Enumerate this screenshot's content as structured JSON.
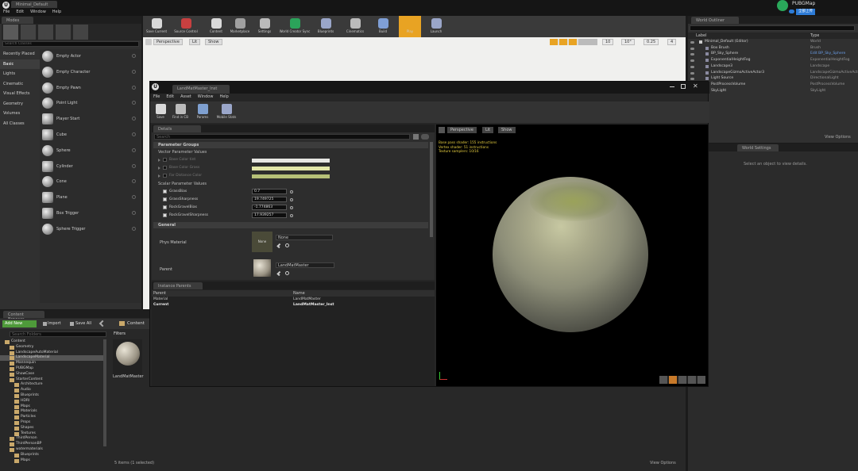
{
  "main": {
    "tab_title": "Minimal_Default",
    "menu": [
      "File",
      "Edit",
      "Window",
      "Help"
    ],
    "project_name": "PUBGMap",
    "badge": "全部上传"
  },
  "toolbar": [
    {
      "label": "Save Current",
      "color": "#d9d9d9"
    },
    {
      "label": "Source Control",
      "color": "#c74040"
    },
    {
      "label": "Content",
      "color": "#d9d9d9"
    },
    {
      "label": "Marketplace",
      "color": "#a0a0a0"
    },
    {
      "label": "Settings",
      "color": "#bbbbbb"
    },
    {
      "label": "World Creator Sync",
      "color": "#2ba35a"
    },
    {
      "label": "Blueprints",
      "color": "#9aa6c9"
    },
    {
      "label": "Cinematics",
      "color": "#bbbbbb"
    },
    {
      "label": "Build",
      "color": "#7f9fd6"
    },
    {
      "label": "Play",
      "color": "#e8a323"
    },
    {
      "label": "Launch",
      "color": "#9aa6c9"
    }
  ],
  "viewport": {
    "perspective": "Perspective",
    "lit": "Lit",
    "show": "Show",
    "grid": "10",
    "angle": "10°",
    "scale": "0.25",
    "cam": "4"
  },
  "modes": {
    "tab": "Modes",
    "search_placeholder": "Search Classes",
    "categories": [
      "Recently Placed",
      "Basic",
      "Lights",
      "Cinematic",
      "Visual Effects",
      "Geometry",
      "Volumes",
      "All Classes"
    ],
    "selected_category": "Basic",
    "items": [
      {
        "label": "Empty Actor",
        "icon": "empty-actor-icon"
      },
      {
        "label": "Empty Character",
        "icon": "empty-character-icon"
      },
      {
        "label": "Empty Pawn",
        "icon": "empty-pawn-icon"
      },
      {
        "label": "Point Light",
        "icon": "point-light-icon"
      },
      {
        "label": "Player Start",
        "icon": "player-start-icon"
      },
      {
        "label": "Cube",
        "icon": "cube-icon"
      },
      {
        "label": "Sphere",
        "icon": "sphere-icon"
      },
      {
        "label": "Cylinder",
        "icon": "cylinder-icon"
      },
      {
        "label": "Cone",
        "icon": "cone-icon"
      },
      {
        "label": "Plane",
        "icon": "plane-icon"
      },
      {
        "label": "Box Trigger",
        "icon": "box-trigger-icon"
      },
      {
        "label": "Sphere Trigger",
        "icon": "sphere-trigger-icon"
      }
    ]
  },
  "outliner": {
    "tab": "World Outliner",
    "col_label": "Label",
    "col_type": "Type",
    "rows": [
      {
        "label": "Minimal_Default (Editor)",
        "type": "World"
      },
      {
        "label": "Box Brush",
        "type": "Brush"
      },
      {
        "label": "BP_Sky_Sphere",
        "type": "Edit BP_Sky_Sphere"
      },
      {
        "label": "ExponentialHeightFog",
        "type": "ExponentialHeightFog"
      },
      {
        "label": "Landscape3",
        "type": "Landscape"
      },
      {
        "label": "LandscapeGizmoActiveActor3",
        "type": "LandscapeGizmoActiveActor"
      },
      {
        "label": "Light Source",
        "type": "DirectionalLight"
      },
      {
        "label": "PostProcessVolume",
        "type": "PostProcessVolume"
      },
      {
        "label": "SkyLight",
        "type": "SkyLight"
      }
    ],
    "view_options": "View Options"
  },
  "world_settings": {
    "tab": "World Settings",
    "empty_text": "Select an object to view details."
  },
  "material_editor": {
    "tab": "LandMatMaster_Inst",
    "menu": [
      "File",
      "Edit",
      "Asset",
      "Window",
      "Help"
    ],
    "toolbar": [
      "Save",
      "Find in CB",
      "Params",
      "Mobile Stats"
    ],
    "details_tab": "Details",
    "search_placeholder": "Search",
    "groups_header": "Parameter Groups",
    "vector_header": "Vector Parameter Values",
    "vector_params": [
      {
        "name": "Base Color tint",
        "color": "#e6e6e2"
      },
      {
        "name": "Base Color Grass",
        "color": "#e2e6a8"
      },
      {
        "name": "Far Distance Color",
        "color": "#b6c078"
      }
    ],
    "scalar_header": "Scalar Parameter Values",
    "scalar_params": [
      {
        "name": "GrassBias",
        "value": "0.7"
      },
      {
        "name": "GrassSharpness",
        "value": "19.749725"
      },
      {
        "name": "RockGravelBias",
        "value": "-1.774863"
      },
      {
        "name": "RockGravelSharpness",
        "value": "17.939257"
      }
    ],
    "general_header": "General",
    "phys_material_label": "Phys Material",
    "phys_material_value": "None",
    "phys_thumb_text": "None",
    "parent_label": "Parent",
    "parent_value": "LandMatMaster",
    "instance_tab": "Instance Parents",
    "instance_cols": [
      "Parent",
      "Name"
    ],
    "instance_rows": [
      [
        "Material",
        "LandMatMaster"
      ],
      [
        "Current",
        "LandMatMaster_Inst"
      ]
    ],
    "preview_perspective": "Perspective",
    "preview_lit": "Lit",
    "preview_show": "Show",
    "stats": [
      "Base pass shader: 155 instructions",
      "Vertex shader: 51 instructions",
      "Texture samplers: 10/16"
    ]
  },
  "content_browser": {
    "tab": "Content Browser",
    "add_new": "Add New",
    "import": "Import",
    "save_all": "Save All",
    "path": "Content",
    "search_folders": "Search Folders",
    "filters": "Filters",
    "asset_name": "LandMatMaster",
    "status": "5 items (1 selected)",
    "view_options": "View Options",
    "tree": [
      {
        "label": "Content",
        "indent": 0
      },
      {
        "label": "Geometry",
        "indent": 1
      },
      {
        "label": "LandscapeAutoMaterial",
        "indent": 1
      },
      {
        "label": "LandscapeMaterial",
        "indent": 1
      },
      {
        "label": "Mannequin",
        "indent": 1
      },
      {
        "label": "PUBGMap",
        "indent": 1
      },
      {
        "label": "ShowCase",
        "indent": 1
      },
      {
        "label": "StarterContent",
        "indent": 1
      },
      {
        "label": "Architecture",
        "indent": 2
      },
      {
        "label": "Audio",
        "indent": 2
      },
      {
        "label": "Blueprints",
        "indent": 2
      },
      {
        "label": "HDRI",
        "indent": 2
      },
      {
        "label": "Maps",
        "indent": 2
      },
      {
        "label": "Materials",
        "indent": 2
      },
      {
        "label": "Particles",
        "indent": 2
      },
      {
        "label": "Props",
        "indent": 2
      },
      {
        "label": "Shapes",
        "indent": 2
      },
      {
        "label": "Textures",
        "indent": 2
      },
      {
        "label": "ThirdPerson",
        "indent": 1
      },
      {
        "label": "ThirdPersonBP",
        "indent": 1
      },
      {
        "label": "watermaterials",
        "indent": 1
      },
      {
        "label": "Blueprints",
        "indent": 2
      },
      {
        "label": "Maps",
        "indent": 2
      }
    ],
    "selected_tree": "LandscapeMaterial"
  }
}
